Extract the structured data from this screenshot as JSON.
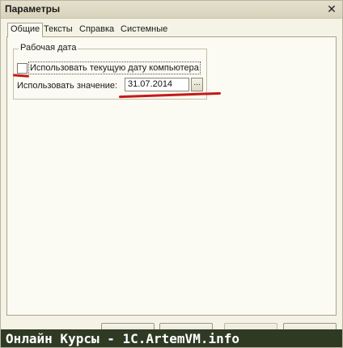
{
  "window": {
    "title": "Параметры",
    "close_glyph": "✕"
  },
  "tabs": [
    {
      "label": "Общие",
      "active": true
    },
    {
      "label": "Тексты",
      "active": false
    },
    {
      "label": "Справка",
      "active": false
    },
    {
      "label": "Системные",
      "active": false
    }
  ],
  "work_date": {
    "group_title": "Рабочая дата",
    "use_computer_date_label": "Использовать текущую дату компьютера",
    "use_computer_date_checked": false,
    "use_value_label": "Использовать значение:",
    "date_value": "31.07.2014",
    "date_button_label": "..."
  },
  "annotations": {
    "highlight_color": "#c41a1a"
  },
  "banner": {
    "text": "Онлайн Курсы - 1C.ArtemVM.info"
  },
  "icons": {
    "close": "close-icon",
    "checkbox": "checkbox-icon"
  }
}
